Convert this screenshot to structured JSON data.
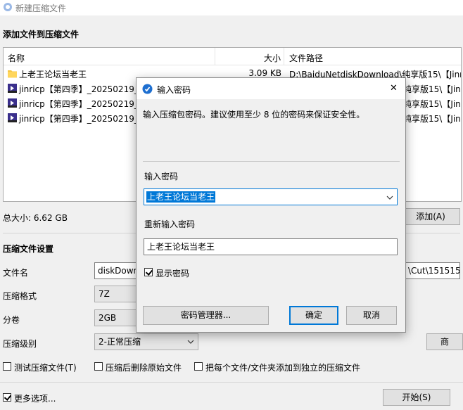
{
  "window": {
    "title": "新建压缩文件"
  },
  "add_section": {
    "heading": "添加文件到压缩文件",
    "columns": {
      "name": "名称",
      "size": "大小",
      "path": "文件路径"
    },
    "files": [
      {
        "type": "folder",
        "name": "上老王论坛当老王",
        "size": "3.09 KB",
        "path": "D:\\BaiduNetdiskDownload\\纯享版15\\【Jinri"
      },
      {
        "type": "mp4",
        "name": "jinricp【第四季】_20250219_文",
        "size": "",
        "path": "纯享版15\\【Jinri"
      },
      {
        "type": "mp4",
        "name": "jinricp【第四季】_20250219_福",
        "size": "",
        "path": "纯享版15\\【Jinri"
      },
      {
        "type": "mp4",
        "name": "jinricp【第四季】_20250219_韩",
        "size": "",
        "path": "纯享版15\\【Jinri"
      }
    ],
    "total_label": "总大小: 6.62 GB",
    "add_button": "添加(A)"
  },
  "settings": {
    "heading": "压缩文件设置",
    "filename_label": "文件名",
    "filename_value": "diskDown",
    "filename_tail": "\\Cut\\151515.",
    "format_label": "压缩格式",
    "format_value": "7Z",
    "split_label": "分卷",
    "split_value": "2GB",
    "level_label": "压缩级别",
    "level_value": "2-正常压缩",
    "test_label": "测试压缩文件(T)",
    "delete_label": "压缩后删除原始文件",
    "separate_label": "把每个文件/文件夹添加到独立的压缩文件",
    "right_button": "商"
  },
  "footer": {
    "more_label": "更多选项...",
    "start_button": "开始(S)"
  },
  "dialog": {
    "title": "输入密码",
    "message": "输入压缩包密码。建议使用至少 8 位的密码来保证安全性。",
    "password_label": "输入密码",
    "password_value": "上老王论坛当老王",
    "reenter_label": "重新输入密码",
    "reenter_value": "上老王论坛当老王",
    "show_password_label": "显示密码",
    "manager_button": "密码管理器...",
    "ok_button": "确定",
    "cancel_button": "取消",
    "close_glyph": "✕"
  },
  "colors": {
    "accent": "#0078d7",
    "selection": "#0078d7",
    "title_icon": "#1e6fd0"
  }
}
